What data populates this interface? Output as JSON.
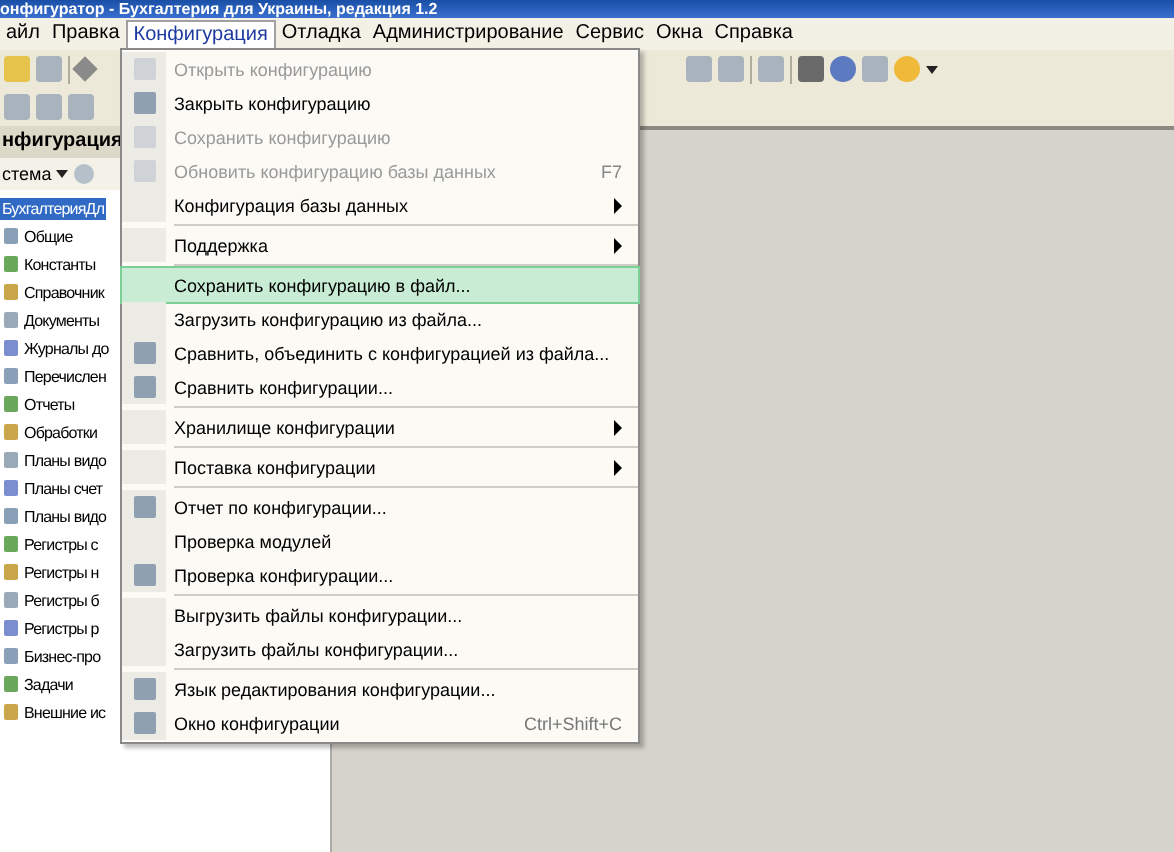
{
  "window": {
    "title": "онфигуратор - Бухгалтерия для Украины, редакция 1.2"
  },
  "menu_bar": [
    {
      "label": "айл",
      "selected": false
    },
    {
      "label": "Правка",
      "selected": false
    },
    {
      "label": "Конфигурация",
      "selected": true
    },
    {
      "label": "Отладка",
      "selected": false
    },
    {
      "label": "Администрирование",
      "selected": false
    },
    {
      "label": "Сервис",
      "selected": false
    },
    {
      "label": "Окна",
      "selected": false
    },
    {
      "label": "Справка",
      "selected": false
    }
  ],
  "config_panel": {
    "title": "нфигурация",
    "toolbar_label": "стема",
    "tree": [
      {
        "label": "БухгалтерияДл",
        "selected": true,
        "children": [
          {
            "label": "Общие",
            "selected": false
          },
          {
            "label": "Константы",
            "selected": false
          },
          {
            "label": "Справочник",
            "selected": false
          },
          {
            "label": "Документы",
            "selected": false
          },
          {
            "label": "Журналы до",
            "selected": false
          },
          {
            "label": "Перечислен",
            "selected": false
          },
          {
            "label": "Отчеты",
            "selected": false
          },
          {
            "label": "Обработки",
            "selected": false
          },
          {
            "label": "Планы видо",
            "selected": false
          },
          {
            "label": "Планы счет",
            "selected": false
          },
          {
            "label": "Планы видо",
            "selected": false
          },
          {
            "label": "Регистры с",
            "selected": false
          },
          {
            "label": "Регистры н",
            "selected": false
          },
          {
            "label": "Регистры б",
            "selected": false
          },
          {
            "label": "Регистры р",
            "selected": false
          },
          {
            "label": "Бизнес-про",
            "selected": false
          },
          {
            "label": "Задачи",
            "selected": false
          },
          {
            "label": "Внешние ис",
            "selected": false
          }
        ]
      }
    ]
  },
  "dropdown_menu": [
    {
      "kind": "item",
      "label": "Открыть конфигурацию",
      "disabled": true,
      "selected": false,
      "has_icon": true
    },
    {
      "kind": "item",
      "label": "Закрыть конфигурацию",
      "disabled": false,
      "selected": false,
      "has_icon": true
    },
    {
      "kind": "item",
      "label": "Сохранить конфигурацию",
      "disabled": true,
      "selected": false,
      "has_icon": true
    },
    {
      "kind": "item",
      "label": "Обновить конфигурацию базы данных",
      "shortcut": "F7",
      "disabled": true,
      "selected": false,
      "has_icon": true
    },
    {
      "kind": "submenu",
      "label": "Конфигурация базы данных",
      "disabled": false,
      "selected": false,
      "has_icon": false
    },
    {
      "kind": "separator"
    },
    {
      "kind": "submenu",
      "label": "Поддержка",
      "disabled": false,
      "selected": false,
      "has_icon": false
    },
    {
      "kind": "separator"
    },
    {
      "kind": "item",
      "label": "Сохранить конфигурацию в файл...",
      "disabled": false,
      "selected": true,
      "has_icon": false
    },
    {
      "kind": "item",
      "label": "Загрузить конфигурацию из файла...",
      "disabled": false,
      "selected": false,
      "has_icon": false
    },
    {
      "kind": "item",
      "label": "Сравнить, объединить с конфигурацией из файла...",
      "disabled": false,
      "selected": false,
      "has_icon": true
    },
    {
      "kind": "item",
      "label": "Сравнить конфигурации...",
      "disabled": false,
      "selected": false,
      "has_icon": true
    },
    {
      "kind": "separator"
    },
    {
      "kind": "submenu",
      "label": "Хранилище конфигурации",
      "disabled": false,
      "selected": false,
      "has_icon": false
    },
    {
      "kind": "separator"
    },
    {
      "kind": "submenu",
      "label": "Поставка конфигурации",
      "disabled": false,
      "selected": false,
      "has_icon": false
    },
    {
      "kind": "separator"
    },
    {
      "kind": "item",
      "label": "Отчет по конфигурации...",
      "disabled": false,
      "selected": false,
      "has_icon": true
    },
    {
      "kind": "item",
      "label": "Проверка модулей",
      "disabled": false,
      "selected": false,
      "has_icon": false
    },
    {
      "kind": "item",
      "label": "Проверка конфигурации...",
      "disabled": false,
      "selected": false,
      "has_icon": true
    },
    {
      "kind": "separator"
    },
    {
      "kind": "item",
      "label": "Выгрузить файлы конфигурации...",
      "disabled": false,
      "selected": false,
      "has_icon": false
    },
    {
      "kind": "item",
      "label": "Загрузить файлы конфигурации...",
      "disabled": false,
      "selected": false,
      "has_icon": false
    },
    {
      "kind": "separator"
    },
    {
      "kind": "item",
      "label": "Язык редактирования конфигурации...",
      "disabled": false,
      "selected": false,
      "has_icon": true
    },
    {
      "kind": "item",
      "label": "Окно конфигурации",
      "shortcut": "Ctrl+Shift+C",
      "disabled": false,
      "selected": false,
      "has_icon": true
    }
  ]
}
